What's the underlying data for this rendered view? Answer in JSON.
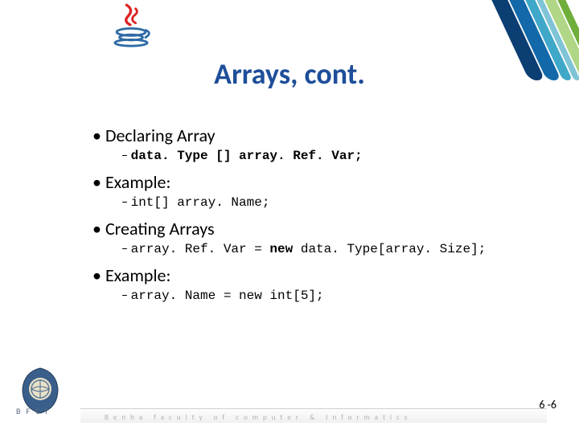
{
  "title": "Arrays, cont.",
  "bullets": [
    {
      "heading": "Declaring Array",
      "code_plain": "data. Type [] array. Ref. Var;",
      "bold_first": true
    },
    {
      "heading": "Example:",
      "code_plain": "int[] array. Name;"
    },
    {
      "heading": "Creating Arrays",
      "code_plain": "array. Ref. Var = ",
      "code_bold_mid": "new",
      "code_tail": " data. Type[array. Size];"
    },
    {
      "heading": "Example:",
      "code_plain": "array. Name = new int[5];"
    }
  ],
  "page_number": "6 -6",
  "footer": {
    "brand": "BFCI",
    "institution": "Benha faculty of computer & Informatics"
  }
}
